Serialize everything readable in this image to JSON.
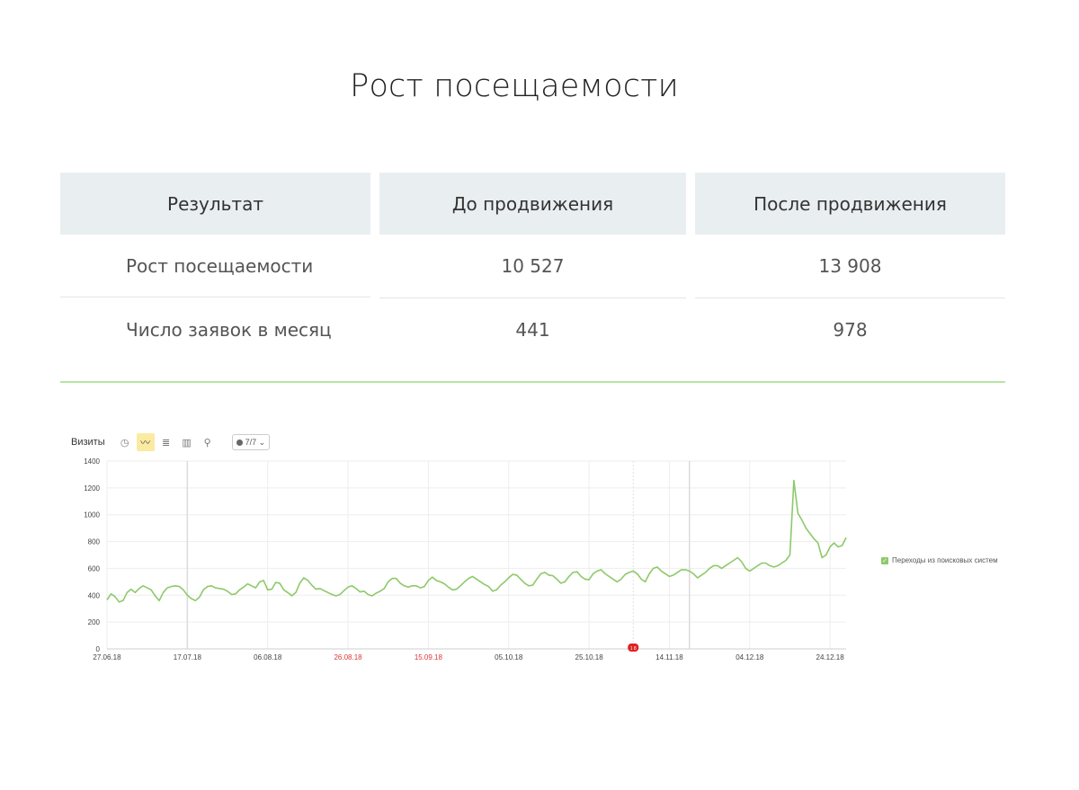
{
  "page": {
    "title": "Рост посещаемости"
  },
  "table": {
    "headers": [
      "Результат",
      "До продвижения",
      "После продвижения"
    ],
    "rows": [
      {
        "label": "Рост посещаемости",
        "before": "10 527",
        "after": "13 908"
      },
      {
        "label": "Число заявок в месяц",
        "before": "441",
        "after": "978"
      }
    ]
  },
  "toolbar": {
    "title": "Визиты",
    "icons": [
      "clock-icon",
      "line-chart-icon",
      "stacked-area-icon",
      "bar-chart-icon",
      "map-pin-icon"
    ],
    "active_icon": "line-chart-icon",
    "dropdown": "7/7"
  },
  "colors": {
    "line": "#8ec96a",
    "grid": "#eeeeee",
    "divider": "#b6e6a4",
    "weekend_tick": "#d9373b",
    "marker": "#e02020"
  },
  "chart_data": {
    "type": "line",
    "series": [
      {
        "name": "Переходы из поисковых систем",
        "start": "27.06.18",
        "days": 181,
        "values": [
          365,
          410,
          390,
          350,
          360,
          420,
          445,
          420,
          450,
          470,
          455,
          440,
          395,
          360,
          420,
          455,
          465,
          470,
          465,
          440,
          400,
          375,
          360,
          385,
          440,
          465,
          470,
          455,
          450,
          445,
          430,
          405,
          410,
          440,
          460,
          485,
          470,
          455,
          500,
          510,
          440,
          445,
          495,
          490,
          440,
          420,
          395,
          420,
          490,
          530,
          510,
          475,
          445,
          450,
          435,
          420,
          405,
          395,
          405,
          435,
          460,
          470,
          450,
          425,
          430,
          405,
          395,
          415,
          430,
          450,
          500,
          525,
          525,
          490,
          470,
          460,
          470,
          470,
          455,
          465,
          510,
          535,
          510,
          500,
          485,
          460,
          440,
          445,
          470,
          500,
          525,
          540,
          520,
          500,
          480,
          465,
          430,
          440,
          475,
          500,
          530,
          555,
          550,
          520,
          490,
          470,
          475,
          520,
          560,
          570,
          550,
          545,
          520,
          490,
          500,
          540,
          570,
          575,
          540,
          520,
          515,
          560,
          580,
          590,
          560,
          540,
          520,
          500,
          520,
          555,
          570,
          580,
          560,
          520,
          500,
          560,
          600,
          610,
          580,
          560,
          540,
          550,
          570,
          590,
          590,
          580,
          560,
          530,
          550,
          570,
          600,
          620,
          620,
          600,
          620,
          640,
          660,
          680,
          650,
          600,
          580,
          600,
          620,
          640,
          640,
          620,
          610,
          620,
          640,
          660,
          700,
          1255,
          1010,
          960,
          900,
          860,
          820,
          790,
          680,
          700,
          760,
          790,
          760,
          770,
          830
        ]
      }
    ],
    "x_ticks": [
      {
        "label": "27.06.18",
        "day": 0,
        "weekend": false
      },
      {
        "label": "17.07.18",
        "day": 20,
        "weekend": false
      },
      {
        "label": "06.08.18",
        "day": 40,
        "weekend": false
      },
      {
        "label": "26.08.18",
        "day": 60,
        "weekend": true
      },
      {
        "label": "15.09.18",
        "day": 80,
        "weekend": true
      },
      {
        "label": "05.10.18",
        "day": 100,
        "weekend": false
      },
      {
        "label": "25.10.18",
        "day": 120,
        "weekend": false
      },
      {
        "label": "14.11.18",
        "day": 140,
        "weekend": false
      },
      {
        "label": "04.12.18",
        "day": 160,
        "weekend": false
      },
      {
        "label": "24.12.18",
        "day": 180,
        "weekend": false
      }
    ],
    "y_ticks": [
      "0",
      "200",
      "400",
      "600",
      "800",
      "1000",
      "1200",
      "1400"
    ],
    "ylim": [
      0,
      1400
    ],
    "xlim": [
      "27.06.18",
      "26.12.18"
    ],
    "grid": true,
    "legend_position": "right",
    "annotation": {
      "label": "1 8",
      "day": 131
    }
  }
}
